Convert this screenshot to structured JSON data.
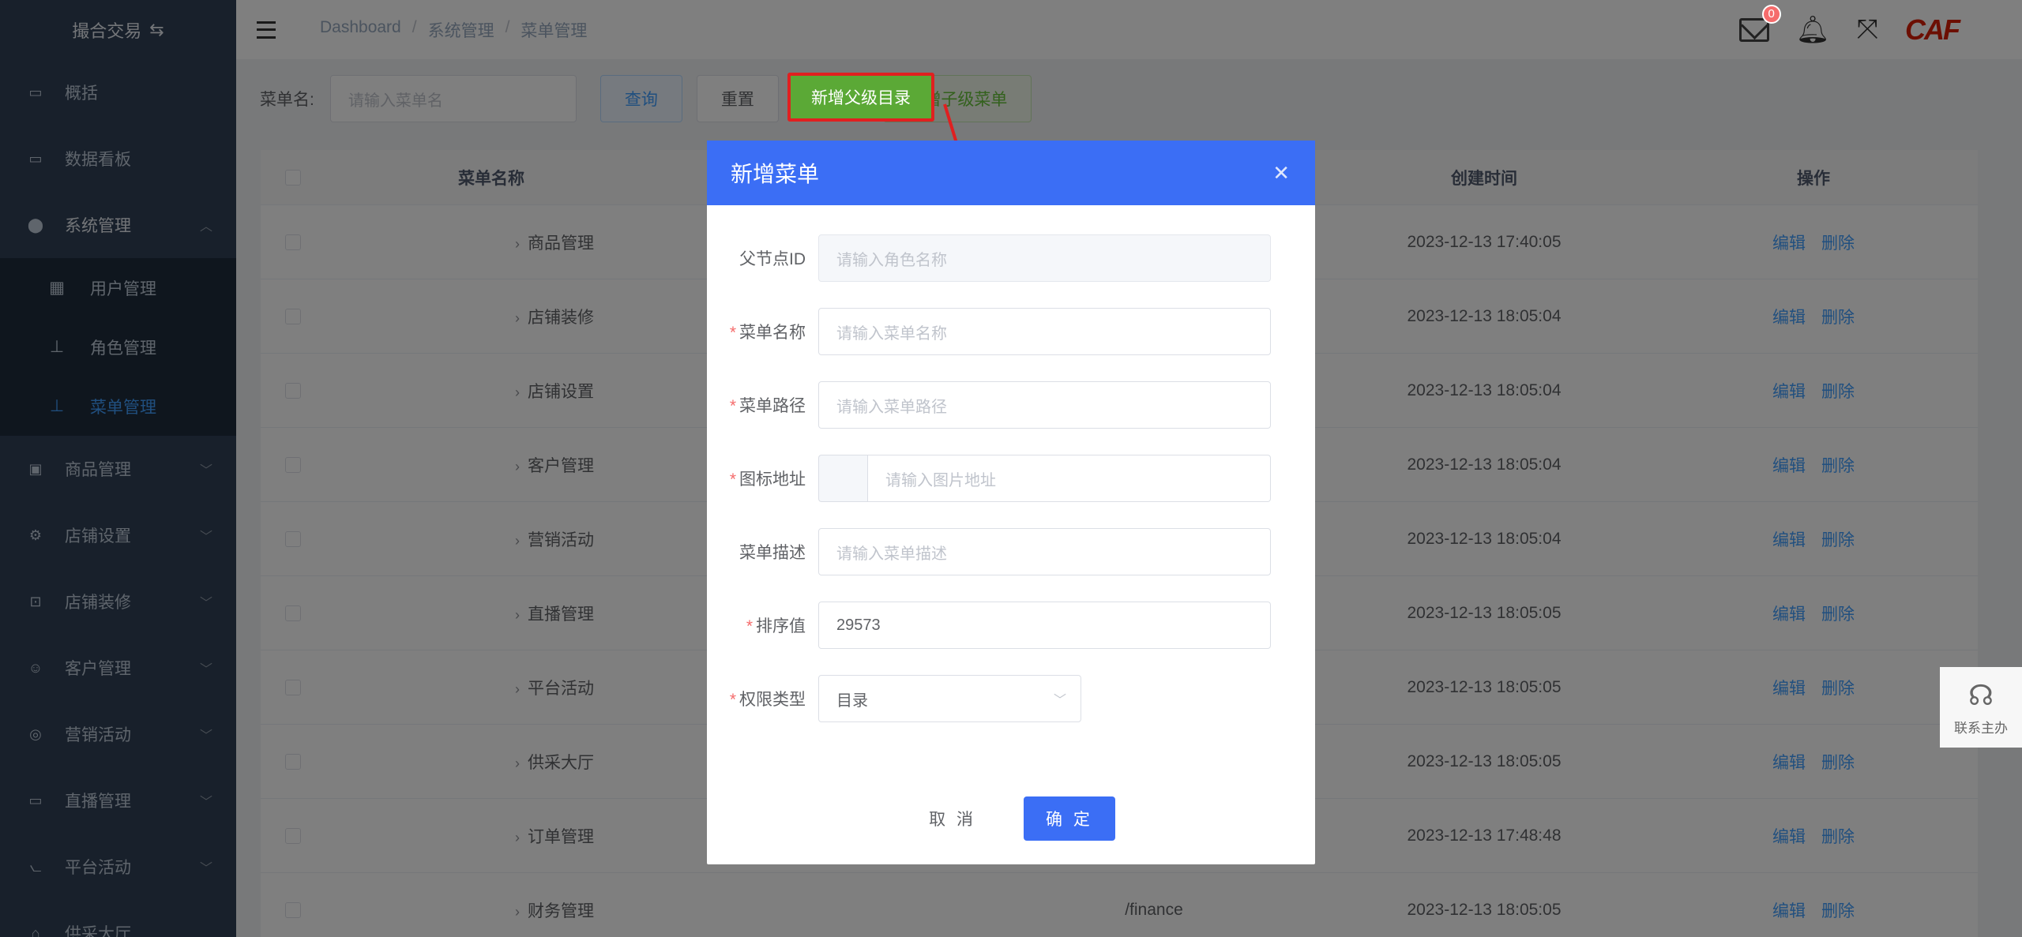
{
  "sidebar": {
    "brand": "撮合交易",
    "items": [
      {
        "label": "概括",
        "icon": "monitor-icon"
      },
      {
        "label": "数据看板",
        "icon": "monitor-icon"
      },
      {
        "label": "系统管理",
        "icon": "settings-icon",
        "expanded": true
      },
      {
        "label": "商品管理",
        "icon": "gift-icon"
      },
      {
        "label": "店铺设置",
        "icon": "gear-icon"
      },
      {
        "label": "店铺装修",
        "icon": "cart-icon"
      },
      {
        "label": "客户管理",
        "icon": "user-icon"
      },
      {
        "label": "营销活动",
        "icon": "compass-icon"
      },
      {
        "label": "直播管理",
        "icon": "video-icon"
      },
      {
        "label": "平台活动",
        "icon": "chart-icon"
      },
      {
        "label": "供采大厅",
        "icon": "hall-icon"
      }
    ],
    "subitems": [
      {
        "label": "用户管理",
        "icon": "table-icon"
      },
      {
        "label": "角色管理",
        "icon": "tree-icon"
      },
      {
        "label": "菜单管理",
        "icon": "tree-icon",
        "active": true
      }
    ]
  },
  "header": {
    "breadcrumb": [
      "Dashboard",
      "系统管理",
      "菜单管理"
    ],
    "mail_badge": "0",
    "logo_text": "CAF"
  },
  "toolbar": {
    "label": "菜单名:",
    "search_placeholder": "请输入菜单名",
    "query": "查询",
    "reset": "重置",
    "add_parent": "新增父级目录",
    "add_child": "新增子级菜单"
  },
  "table": {
    "headers": [
      "菜单名称",
      "",
      "",
      "创建时间",
      "操作"
    ],
    "rows": [
      {
        "name": "商品管理",
        "path": "",
        "time": "2023-12-13 17:40:05"
      },
      {
        "name": "店铺装修",
        "path": "",
        "time": "2023-12-13 18:05:04"
      },
      {
        "name": "店铺设置",
        "path": "",
        "time": "2023-12-13 18:05:04"
      },
      {
        "name": "客户管理",
        "path": "",
        "time": "2023-12-13 18:05:04"
      },
      {
        "name": "营销活动",
        "path": "",
        "time": "2023-12-13 18:05:04"
      },
      {
        "name": "直播管理",
        "path": "",
        "time": "2023-12-13 18:05:05"
      },
      {
        "name": "平台活动",
        "path": "",
        "time": "2023-12-13 18:05:05"
      },
      {
        "name": "供采大厅",
        "path": "",
        "time": "2023-12-13 18:05:05"
      },
      {
        "name": "订单管理",
        "path": "",
        "time": "2023-12-13 17:48:48"
      },
      {
        "name": "财务管理",
        "path": "/finance",
        "time": "2023-12-13 18:05:05"
      }
    ],
    "edit": "编辑",
    "delete": "删除"
  },
  "dialog": {
    "title": "新增菜单",
    "fields": {
      "parent_id": {
        "label": "父节点ID",
        "placeholder": "请输入角色名称"
      },
      "menu_name": {
        "label": "菜单名称",
        "placeholder": "请输入菜单名称"
      },
      "menu_path": {
        "label": "菜单路径",
        "placeholder": "请输入菜单路径"
      },
      "icon_url": {
        "label": "图标地址",
        "placeholder": "请输入图片地址"
      },
      "menu_desc": {
        "label": "菜单描述",
        "placeholder": "请输入菜单描述"
      },
      "sort": {
        "label": "排序值",
        "value": "29573"
      },
      "perm_type": {
        "label": "权限类型",
        "value": "目录"
      }
    },
    "cancel": "取 消",
    "ok": "确 定"
  },
  "contact": {
    "label": "联系主办"
  }
}
